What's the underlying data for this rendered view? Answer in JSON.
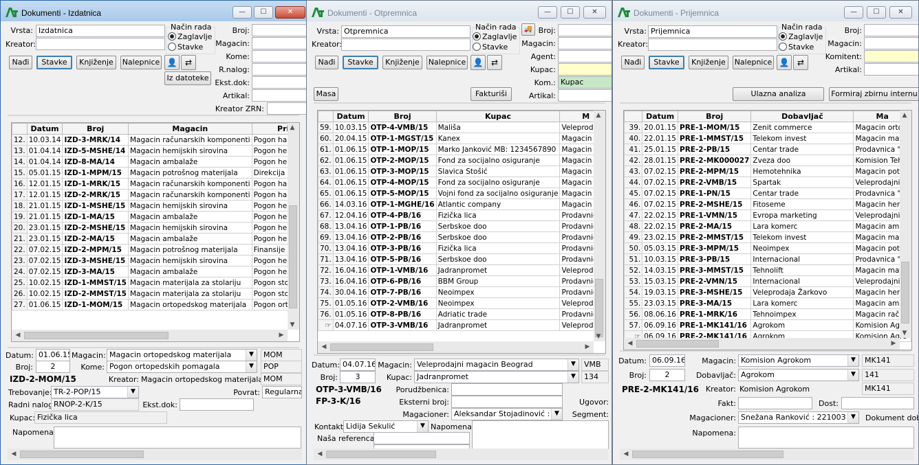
{
  "common": {
    "btn_nadji": "Nađi",
    "btn_stavke": "Stavke",
    "btn_knjizenje": "Knjiženje",
    "btn_nalepnice": "Nalepnice",
    "lbl_vrsta": "Vrsta:",
    "lbl_kreator": "Kreator:",
    "lbl_nacin": "Način rada",
    "radio_zaglavlje": "Zaglavlje",
    "radio_stavke": "Stavke",
    "lbl_broj": "Broj:",
    "lbl_magacin": "Magacin:",
    "lbl_artikal": "Artikal:",
    "lbl_datum": "Datum:",
    "lbl_broj2": "Broj:",
    "lbl_napomena": "Napomena:",
    "col_datum": "Datum",
    "col_broj": "Broj"
  },
  "w1": {
    "title": "Dokumenti - Izdatnica",
    "vrsta_value": "Izdatnica",
    "lbl_kome": "Kome:",
    "lbl_rnalog": "R.nalog:",
    "lbl_ekstdok": "Ekst.dok:",
    "lbl_kreator_zrn": "Kreator ZRN:",
    "btn_iz_datoteke": "Iz datoteke",
    "col3": "Magacin",
    "col4": "Prim",
    "rows": [
      [
        "12.",
        "10.03.14",
        "IZD-3-MRK/14",
        "Magacin računarskih komponenti",
        "Pogon hardvera"
      ],
      [
        "13.",
        "01.04.14",
        "IZD-5-MSHE/14",
        "Magacin hemijskih sirovina",
        "Pogon hemijskih"
      ],
      [
        "14.",
        "01.04.14",
        "IZD-8-MA/14",
        "Magacin ambalaže",
        "Pogon hemijskih"
      ],
      [
        "15.",
        "05.01.15",
        "IZD-1-MPM/15",
        "Magacin potrošnog materijala",
        "Direkcija"
      ],
      [
        "16.",
        "12.01.15",
        "IZD-1-MRK/15",
        "Magacin računarskih komponenti",
        "Pogon hardvera"
      ],
      [
        "17.",
        "12.01.15",
        "IZD-2-MRK/15",
        "Magacin računarskih komponenti",
        "Pogon hardvera"
      ],
      [
        "18.",
        "21.01.15",
        "IZD-1-MSHE/15",
        "Magacin hemijskih sirovina",
        "Pogon hemijskih"
      ],
      [
        "19.",
        "21.01.15",
        "IZD-1-MA/15",
        "Magacin ambalaže",
        "Pogon hemijskih"
      ],
      [
        "20.",
        "23.01.15",
        "IZD-2-MSHE/15",
        "Magacin hemijskih sirovina",
        "Pogon hemijskih"
      ],
      [
        "21.",
        "23.01.15",
        "IZD-2-MA/15",
        "Magacin ambalaže",
        "Pogon hemijskih"
      ],
      [
        "22.",
        "07.02.15",
        "IZD-2-MPM/15",
        "Magacin potrošnog materijala",
        "Finansije"
      ],
      [
        "23.",
        "07.02.15",
        "IZD-3-MSHE/15",
        "Magacin hemijskih sirovina",
        "Pogon hemijskih"
      ],
      [
        "24.",
        "07.02.15",
        "IZD-3-MA/15",
        "Magacin ambalaže",
        "Pogon hemijskih"
      ],
      [
        "25.",
        "10.02.15",
        "IZD-1-MMST/15",
        "Magacin materijala za stolariju",
        "Pogon stolarije"
      ],
      [
        "26.",
        "10.02.15",
        "IZD-2-MMST/15",
        "Magacin materijala za stolariju",
        "Pogon stolarije"
      ],
      [
        "27.",
        "01.06.15",
        "IZD-1-MOM/15",
        "Magacin ortopedskog materijala",
        "Pogon ortopedskih"
      ]
    ],
    "d_datum": "01.06.15",
    "d_magacin": "Magacin ortopedskog materijala",
    "d_magacin_code": "MOM",
    "d_broj": "2",
    "d_kome": "Pogon ortopedskih pomagala",
    "d_kome_code": "POP",
    "d_doc": "IZD-2-MOM/15",
    "lbl_kreator": "Kreator:",
    "d_kreator": "Magacin ortopedskog materijala",
    "d_kreator_code": "MOM",
    "lbl_trebovanje": "Trebovanje:",
    "d_trebovanje": "TR-2-POP/15",
    "lbl_povrat": "Povrat:",
    "d_povrat": "Regularna",
    "lbl_radni_nalog": "Radni nalog:",
    "d_radni_nalog": "RNOP-2-K/15",
    "lbl_ekst": "Ekst.dok:",
    "lbl_kupac": "Kupac:",
    "d_kupac": "Fizička lica"
  },
  "w2": {
    "title": "Dokumenti - Otpremnica",
    "vrsta_value": "Otpremnica",
    "lbl_agent": "Agent:",
    "lbl_kupac": "Kupac:",
    "lbl_kom": "Kom.:",
    "kom_value": "Kupac",
    "btn_masa": "Masa",
    "btn_fakturisi": "Fakturiši",
    "col3": "Kupac",
    "col4": "M",
    "rows": [
      [
        "59.",
        "10.03.15",
        "OTP-4-VMB/15",
        "Mališa",
        "Veleprodajni"
      ],
      [
        "60.",
        "20.04.15",
        "OTP-1-MGST/15",
        "Kanex",
        "Magacin got"
      ],
      [
        "61.",
        "01.06.15",
        "OTP-1-MOP/15",
        "Marko Janković MB: 1234567890",
        "Magacin orto"
      ],
      [
        "62.",
        "01.06.15",
        "OTP-2-MOP/15",
        "Fond za socijalno osiguranje",
        "Magacin orto"
      ],
      [
        "63.",
        "01.06.15",
        "OTP-3-MOP/15",
        "Slavica Stošić",
        "Magacin orto"
      ],
      [
        "64.",
        "01.06.15",
        "OTP-4-MOP/15",
        "Fond za socijalno osiguranje",
        "Magacin orto"
      ],
      [
        "65.",
        "01.06.15",
        "OTP-5-MOP/15",
        "Vojni fond za socijalno osiguranje",
        "Magacin orto"
      ],
      [
        "66.",
        "14.03.16",
        "OTP-1-MGHE/16",
        "Atlantic company",
        "Magacin hem"
      ],
      [
        "67.",
        "12.04.16",
        "OTP-4-PB/16",
        "Fizička lica",
        "Prodavnica \""
      ],
      [
        "68.",
        "13.04.16",
        "OTP-1-PB/16",
        "Serbskoe doo",
        "Prodavnica \""
      ],
      [
        "69.",
        "13.04.16",
        "OTP-2-PB/16",
        "Serbskoe doo",
        "Prodavnica \""
      ],
      [
        "70.",
        "13.04.16",
        "OTP-3-PB/16",
        "Fizička lica",
        "Prodavnica \""
      ],
      [
        "71.",
        "13.04.16",
        "OTP-5-PB/16",
        "Serbskoe doo",
        "Prodavnica \""
      ],
      [
        "72.",
        "16.04.16",
        "OTP-1-VMB/16",
        "Jadranpromet",
        "Veleprodajni"
      ],
      [
        "73.",
        "16.04.16",
        "OTP-6-PB/16",
        "BBM Group",
        "Prodavnica \""
      ],
      [
        "74.",
        "30.04.16",
        "OTP-7-PB/16",
        "Neoimpex",
        "Prodavnica \""
      ],
      [
        "75.",
        "01.05.16",
        "OTP-2-VMB/16",
        "Neoimpex",
        "Veleprodajni"
      ],
      [
        "76.",
        "01.05.16",
        "OTP-8-PB/16",
        "Adriatic trade",
        "Prodavnica \""
      ],
      [
        "",
        "04.07.16",
        "OTP-3-VMB/16",
        "Jadranpromet",
        "Veleprodajni"
      ]
    ],
    "d_datum": "04.07.16",
    "d_magacin": "Veleprodajni magacin Beograd",
    "d_magacin_code": "VMB",
    "d_broj": "3",
    "lbl_kupac2": "Kupac:",
    "d_kupac": "Jadranpromet",
    "d_kupac_code": "134",
    "d_doc": "OTP-3-VMB/16",
    "d_doc2": "FP-3-K/16",
    "lbl_porudzbenica": "Porudžbenica:",
    "lbl_eksterni": "Eksterni broj:",
    "lbl_ugovor": "Ugovor:",
    "lbl_magacioner": "Magacioner:",
    "d_magacioner": "Aleksandar Stojadinović : 100",
    "lbl_segment": "Segment:",
    "lbl_kontakt": "Kontakt:",
    "d_kontakt": "Lidija Sekulić",
    "lbl_napomena": "Napomena:",
    "lbl_nasa_ref": "Naša referenca:"
  },
  "w3": {
    "title": "Dokumenti - Prijemnica",
    "vrsta_value": "Prijemnica",
    "lbl_komitent": "Komitent:",
    "btn_ulazna": "Ulazna analiza",
    "btn_formiraj": "Formiraj zbirnu internu",
    "col3": "Dobavljač",
    "col4": "Ma",
    "rows": [
      [
        "39.",
        "20.01.15",
        "PRE-1-MOM/15",
        "Zenit commerce",
        "Magacin ortop"
      ],
      [
        "40.",
        "22.01.15",
        "PRE-1-MMST/15",
        "Telekom invest",
        "Magacin mate"
      ],
      [
        "41.",
        "25.01.15",
        "PRE-2-PB/15",
        "Centar trade",
        "Prodavnica \"K"
      ],
      [
        "42.",
        "28.01.15",
        "PRE-2-MK000027",
        "Zveza doo",
        "Komision Tehn"
      ],
      [
        "43.",
        "07.02.15",
        "PRE-2-MPM/15",
        "Hemotehnika",
        "Magacin potro"
      ],
      [
        "44.",
        "07.02.15",
        "PRE-2-VMB/15",
        "Spartak",
        "Veleprodajni m"
      ],
      [
        "45.",
        "07.02.15",
        "PRE-1-PN/15",
        "Centar trade",
        "Prodavnica \"K"
      ],
      [
        "46.",
        "07.02.15",
        "PRE-2-MSHE/15",
        "Fitoseme",
        "Magacin hemij"
      ],
      [
        "47.",
        "22.02.15",
        "PRE-1-VMN/15",
        "Evropa marketing",
        "Veleprodajni m"
      ],
      [
        "48.",
        "22.02.15",
        "PRE-2-MA/15",
        "Lara komerc",
        "Magacin amba"
      ],
      [
        "49.",
        "23.02.15",
        "PRE-2-MMST/15",
        "Telekom invest",
        "Magacin mate"
      ],
      [
        "50.",
        "05.03.15",
        "PRE-3-MPM/15",
        "Neoimpex",
        "Magacin potro"
      ],
      [
        "51.",
        "10.03.15",
        "PRE-3-PB/15",
        "Internacional",
        "Prodavnica \"K"
      ],
      [
        "52.",
        "14.03.15",
        "PRE-3-MMST/15",
        "Tehnolift",
        "Magacin mate"
      ],
      [
        "53.",
        "15.03.15",
        "PRE-2-VMN/15",
        "Internacional",
        "Veleprodajni m"
      ],
      [
        "54.",
        "19.03.15",
        "PRE-3-MSHE/15",
        "Veleprodaja Žarkovo",
        "Magacin hemij"
      ],
      [
        "55.",
        "23.03.15",
        "PRE-3-MA/15",
        "Lara komerc",
        "Magacin amba"
      ],
      [
        "56.",
        "08.06.16",
        "PRE-1-MRK/16",
        "Tehnoimpex",
        "Magacin raču"
      ],
      [
        "57.",
        "06.09.16",
        "PRE-1-MK141/16",
        "Agrokom",
        "Komision Agro"
      ],
      [
        "",
        "06.09.16",
        "PRE-2-MK141/16",
        "Agrokom",
        "Komision Agro"
      ]
    ],
    "d_datum": "06.09.16",
    "d_magacin": "Komision Agrokom",
    "d_magacin_code": "MK141",
    "d_broj": "2",
    "lbl_dobavljac": "Dobavljač:",
    "d_dobavljac": "Agrokom",
    "d_dobavljac_code": "141",
    "d_doc": "PRE-2-MK141/16",
    "lbl_kreator": "Kreator:",
    "d_kreator": "Komision Agrokom",
    "d_kreator_code": "MK141",
    "lbl_fakt": "Fakt:",
    "lbl_dost": "Dost:",
    "lbl_magacioner": "Magacioner:",
    "d_magacioner": "Snežana Ranković : 221003",
    "lbl_dokument": "Dokument dob",
    "lbl_napomena": "Napomena:"
  }
}
